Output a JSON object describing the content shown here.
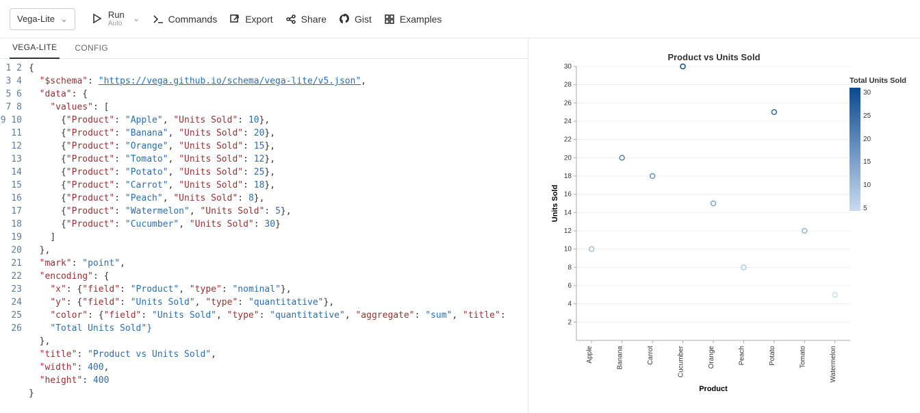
{
  "toolbar": {
    "mode": "Vega-Lite",
    "run": {
      "label": "Run",
      "sub": "Auto"
    },
    "commands": "Commands",
    "export": "Export",
    "share": "Share",
    "gist": "Gist",
    "examples": "Examples"
  },
  "tabs": {
    "vegalite": "VEGA-LITE",
    "config": "CONFIG"
  },
  "editor": {
    "lines": 26,
    "schema_key": "\"$schema\"",
    "schema_val": "\"https://vega.github.io/schema/vega-lite/v5.json\"",
    "data_key": "\"data\"",
    "values_key": "\"values\"",
    "product_key": "\"Product\"",
    "units_key": "\"Units Sold\"",
    "rows": [
      {
        "p": "\"Apple\"",
        "u": "10"
      },
      {
        "p": "\"Banana\"",
        "u": "20"
      },
      {
        "p": "\"Orange\"",
        "u": "15"
      },
      {
        "p": "\"Tomato\"",
        "u": "12"
      },
      {
        "p": "\"Potato\"",
        "u": "25"
      },
      {
        "p": "\"Carrot\"",
        "u": "18"
      },
      {
        "p": "\"Peach\"",
        "u": "8"
      },
      {
        "p": "\"Watermelon\"",
        "u": "5"
      },
      {
        "p": "\"Cucumber\"",
        "u": "30"
      }
    ],
    "mark_key": "\"mark\"",
    "mark_val": "\"point\"",
    "encoding_key": "\"encoding\"",
    "x_line": "\"x\": {\"field\": \"Product\", \"type\": \"nominal\"},",
    "y_line": "\"y\": {\"field\": \"Units Sold\", \"type\": \"quantitative\"},",
    "color_line_a": "\"color\": {\"field\": \"Units Sold\", \"type\": \"quantitative\", \"aggregate\": \"sum\", \"title\":",
    "color_line_b": "\"Total Units Sold\"}",
    "title_key": "\"title\"",
    "title_val": "\"Product vs Units Sold\"",
    "width_key": "\"width\"",
    "width_val": "400",
    "height_key": "\"height\"",
    "height_val": "400"
  },
  "chart_data": {
    "type": "scatter",
    "title": "Product vs Units Sold",
    "xlabel": "Product",
    "ylabel": "Units Sold",
    "categories": [
      "Apple",
      "Banana",
      "Carrot",
      "Cucumber",
      "Orange",
      "Peach",
      "Potato",
      "Tomato",
      "Watermelon"
    ],
    "values": [
      10,
      20,
      18,
      30,
      15,
      8,
      25,
      12,
      5
    ],
    "ylim": [
      0,
      30
    ],
    "yticks": [
      2,
      4,
      6,
      8,
      10,
      12,
      14,
      16,
      18,
      20,
      22,
      24,
      26,
      28,
      30
    ],
    "legend": {
      "title": "Total Units Sold",
      "ticks": [
        "30",
        "25",
        "20",
        "15",
        "10",
        "5"
      ],
      "min": 5,
      "max": 30
    }
  }
}
